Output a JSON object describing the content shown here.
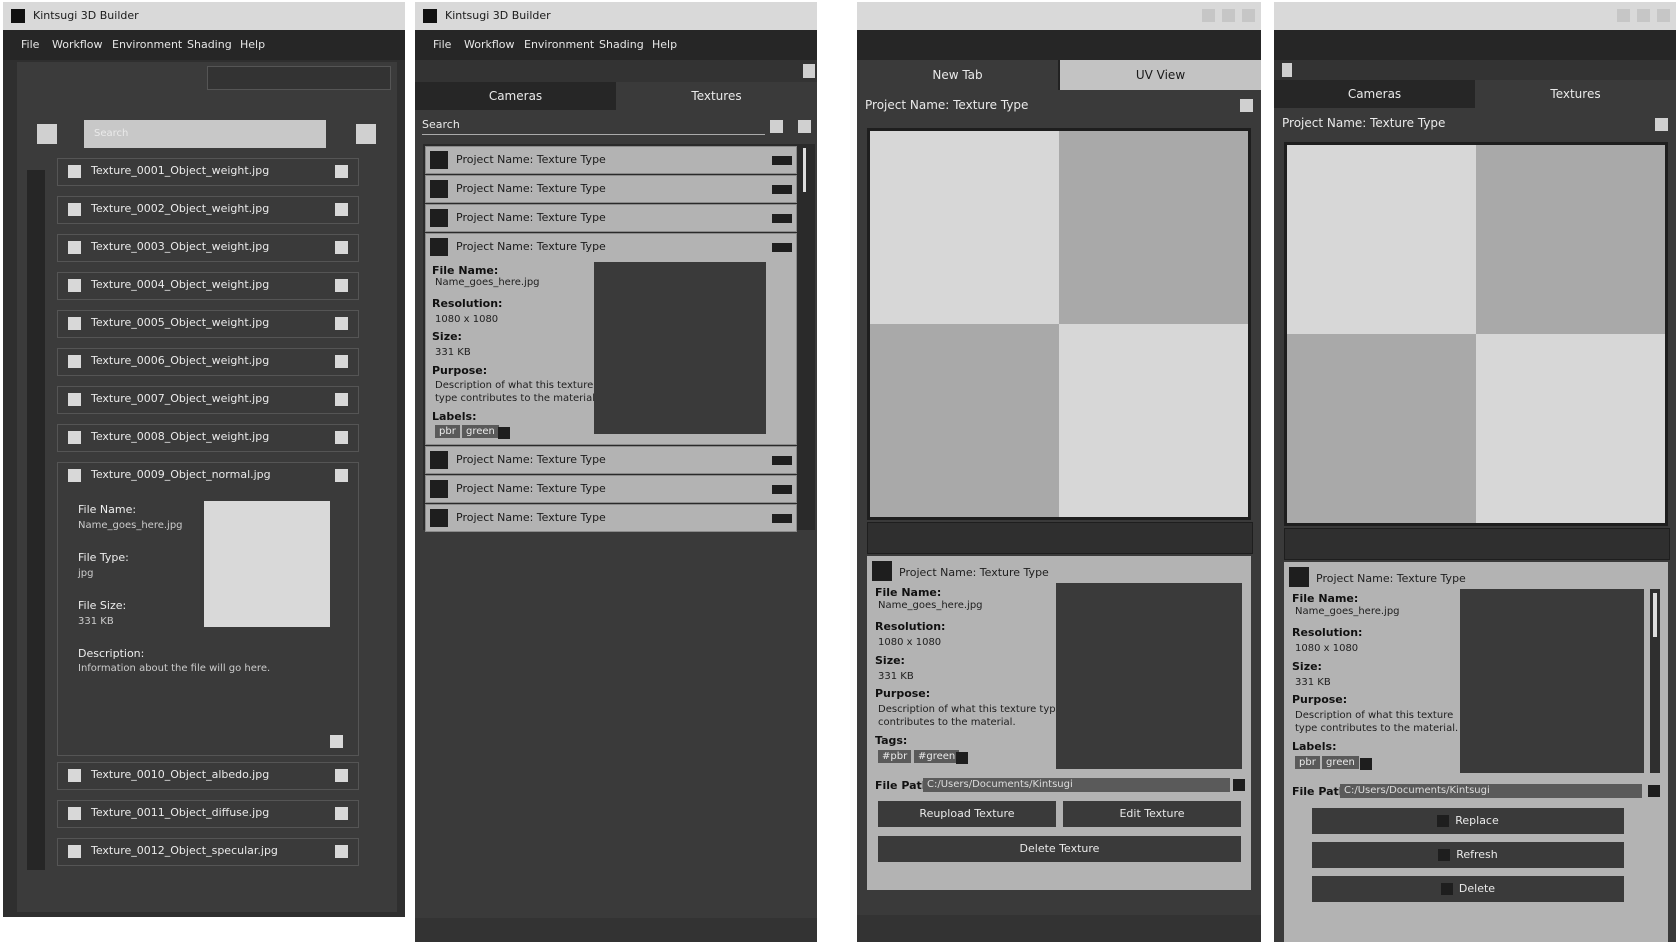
{
  "app_title": "Kintsugi 3D Builder",
  "menu": [
    "File",
    "Workflow",
    "Environment",
    "Shading",
    "Help"
  ],
  "panel1": {
    "search_placeholder": "Search",
    "files": [
      "Texture_0001_Object_weight.jpg",
      "Texture_0002_Object_weight.jpg",
      "Texture_0003_Object_weight.jpg",
      "Texture_0004_Object_weight.jpg",
      "Texture_0005_Object_weight.jpg",
      "Texture_0006_Object_weight.jpg",
      "Texture_0007_Object_weight.jpg",
      "Texture_0008_Object_weight.jpg"
    ],
    "expanded": {
      "name": "Texture_0009_Object_normal.jpg",
      "file_name_label": "File Name:",
      "file_name": "Name_goes_here.jpg",
      "file_type_label": "File Type:",
      "file_type": "jpg",
      "file_size_label": "File Size:",
      "file_size": "331 KB",
      "description_label": "Description:",
      "description": "Information about the file will go here."
    },
    "files_after": [
      "Texture_0010_Object_albedo.jpg",
      "Texture_0011_Object_diffuse.jpg",
      "Texture_0012_Object_specular.jpg"
    ]
  },
  "panel2": {
    "tabs": [
      "Cameras",
      "Textures"
    ],
    "search_label": "Search",
    "row_label": "Project Name: Texture Type",
    "rows_before": 3,
    "rows_after": 3,
    "detail": {
      "file_name_label": "File Name:",
      "file_name": "Name_goes_here.jpg",
      "resolution_label": "Resolution:",
      "resolution": "1080 x 1080",
      "size_label": "Size:",
      "size": "331 KB",
      "purpose_label": "Purpose:",
      "purpose_line1": "Description of what this texture",
      "purpose_line2": "type contributes to the material.",
      "labels_label": "Labels:",
      "labels": [
        "pbr",
        "green"
      ]
    }
  },
  "panel3": {
    "tabs": [
      "New Tab",
      "UV View"
    ],
    "header": "Project Name: Texture Type",
    "detail_title": "Project Name: Texture Type",
    "file_name_label": "File Name:",
    "file_name": "Name_goes_here.jpg",
    "resolution_label": "Resolution:",
    "resolution": "1080 x 1080",
    "size_label": "Size:",
    "size": "331 KB",
    "purpose_label": "Purpose:",
    "purpose_line1": "Description of what this texture type",
    "purpose_line2": "contributes to the material.",
    "tags_label": "Tags:",
    "tags": [
      "#pbr",
      "#green"
    ],
    "file_path_label": "File Path:",
    "file_path": "C:/Users/Documents/Kintsugi",
    "reupload": "Reupload Texture",
    "edit": "Edit Texture",
    "delete": "Delete Texture"
  },
  "panel4": {
    "tabs": [
      "Cameras",
      "Textures"
    ],
    "header": "Project Name: Texture Type",
    "detail_title": "Project Name: Texture Type",
    "file_name_label": "File Name:",
    "file_name": "Name_goes_here.jpg",
    "resolution_label": "Resolution:",
    "resolution": "1080 x 1080",
    "size_label": "Size:",
    "size": "331 KB",
    "purpose_label": "Purpose:",
    "purpose_line1": "Description of what this texture",
    "purpose_line2": "type contributes to the material.",
    "labels_label": "Labels:",
    "labels": [
      "pbr",
      "green"
    ],
    "file_path_label": "File Path:",
    "file_path": "C:/Users/Documents/Kintsugi",
    "replace": "Replace",
    "refresh": "Refresh",
    "delete": "Delete"
  }
}
